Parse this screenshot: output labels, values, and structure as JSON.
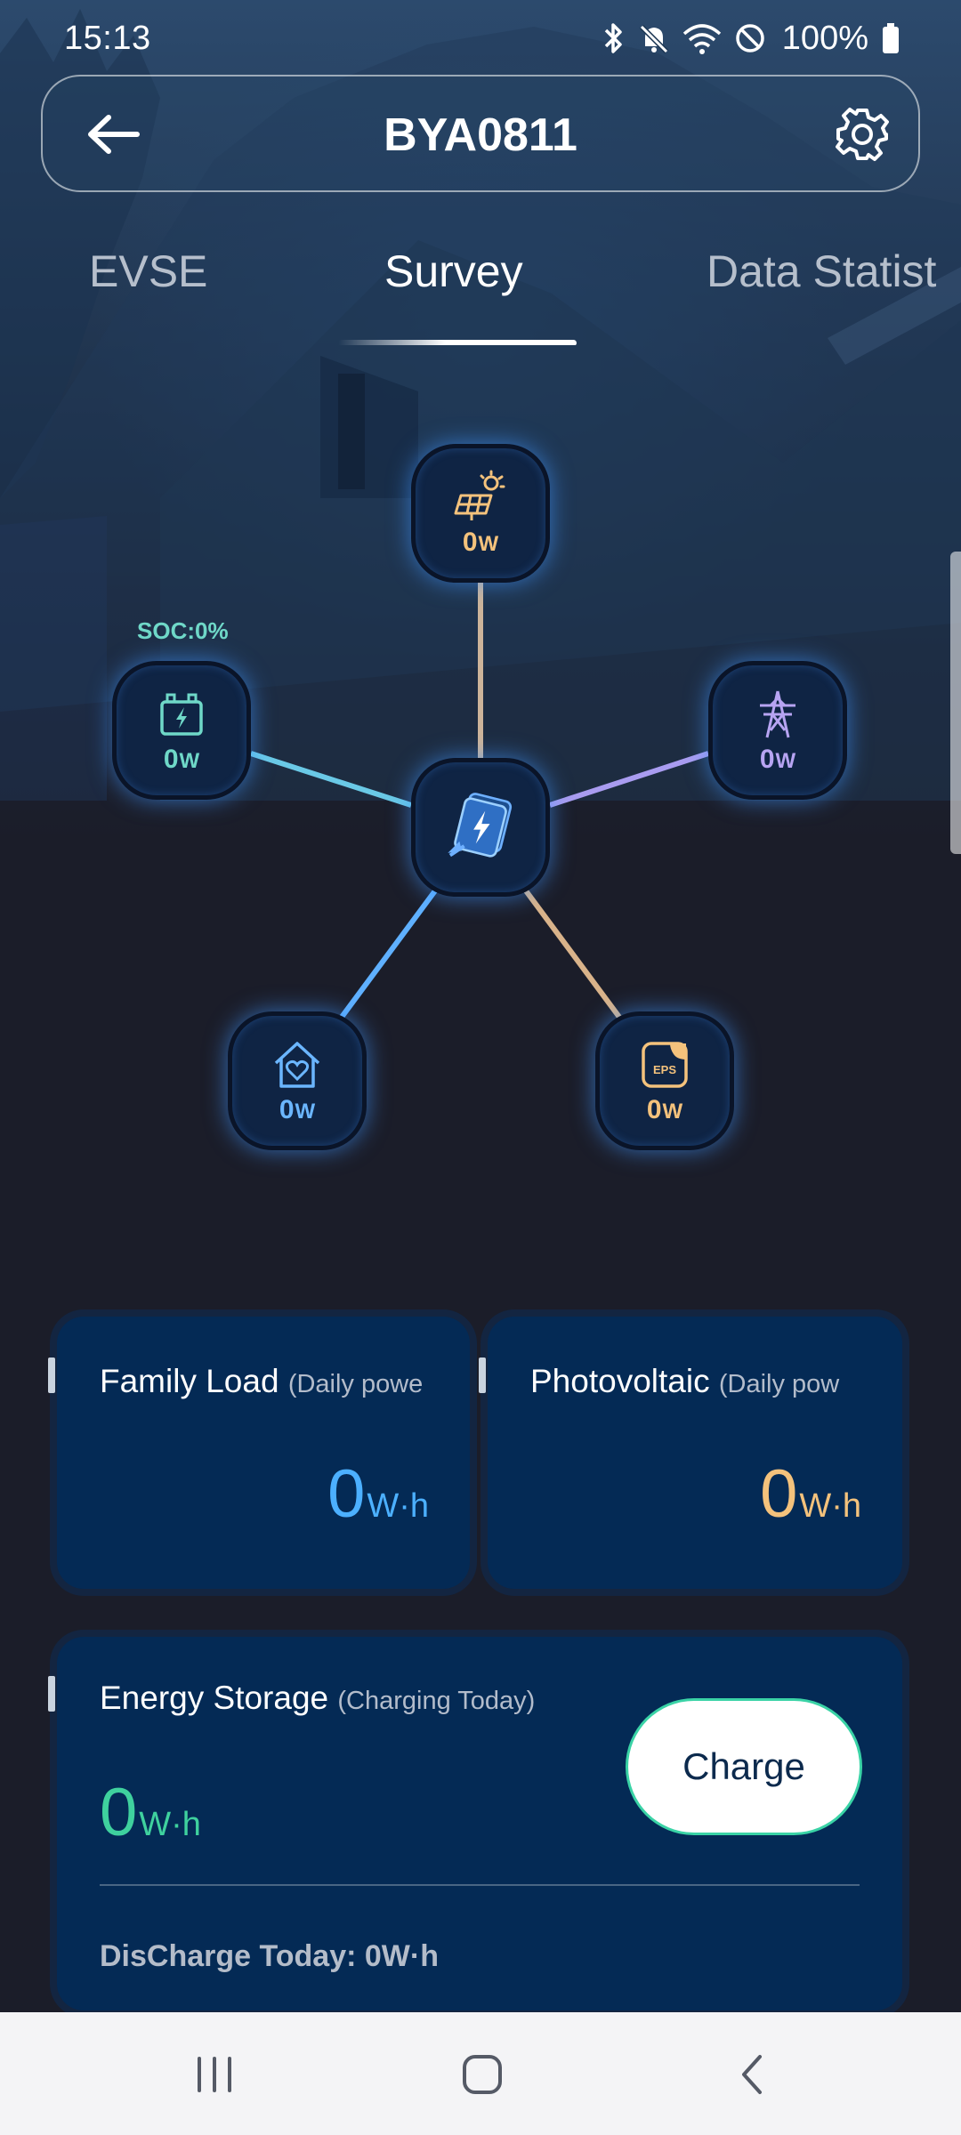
{
  "status_bar": {
    "time": "15:13",
    "battery": "100%",
    "icons": [
      "bluetooth-icon",
      "mute-icon",
      "wifi-icon",
      "dnd-icon",
      "battery-icon"
    ]
  },
  "header": {
    "title": "BYA0811",
    "back_icon": "back-arrow-icon",
    "settings_icon": "gear-icon"
  },
  "tabs": [
    {
      "label": "EVSE",
      "active": false
    },
    {
      "label": "Survey",
      "active": true
    },
    {
      "label": "Data Statist",
      "active": false
    }
  ],
  "flow": {
    "soc": "SOC:0%",
    "pv": {
      "value": "0",
      "unit": "W",
      "icon": "solar-panel-icon"
    },
    "battery": {
      "value": "0",
      "unit": "W",
      "icon": "battery-icon"
    },
    "grid": {
      "value": "0",
      "unit": "W",
      "icon": "power-tower-icon"
    },
    "center_icon": "inverter-icon",
    "home": {
      "value": "0",
      "unit": "W",
      "icon": "home-heart-icon"
    },
    "eps": {
      "value": "0",
      "unit": "W",
      "icon": "eps-icon",
      "badge": "EPS"
    }
  },
  "cards": {
    "family_load": {
      "title": "Family Load",
      "sub": "(Daily powe",
      "value": "0",
      "unit": "W·h"
    },
    "photovoltaic": {
      "title": "Photovoltaic",
      "sub": "(Daily pow",
      "value": "0",
      "unit": "W·h"
    },
    "energy_storage": {
      "title": "Energy Storage",
      "sub": "(Charging Today)",
      "value": "0",
      "unit": "W·h",
      "charge_label": "Charge",
      "discharge": "DisCharge Today: 0W·h"
    }
  },
  "colors": {
    "pv": "#f4c27c",
    "battery": "#6fd8c8",
    "grid": "#b7a4f2",
    "home": "#4cb0ff",
    "storage": "#3fd19e"
  },
  "nav_bar": [
    "recents-icon",
    "home-icon",
    "back-icon"
  ]
}
